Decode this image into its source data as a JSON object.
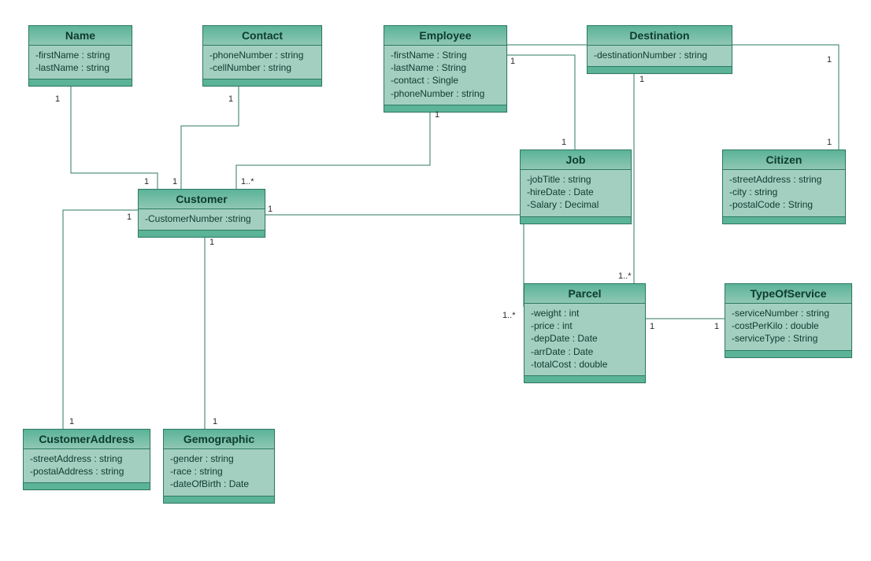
{
  "classes": {
    "name": {
      "title": "Name",
      "attrs": [
        "-firstName : string",
        "-lastName : string"
      ]
    },
    "contact": {
      "title": "Contact",
      "attrs": [
        "-phoneNumber : string",
        "-cellNumber : string"
      ]
    },
    "employee": {
      "title": "Employee",
      "attrs": [
        "-firstName : String",
        "-lastName : String",
        "-contact : Single",
        "-phoneNumber : string"
      ]
    },
    "destination": {
      "title": "Destination",
      "attrs": [
        "-destinationNumber : string"
      ]
    },
    "customer": {
      "title": "Customer",
      "attrs": [
        "-CustomerNumber :string"
      ]
    },
    "job": {
      "title": "Job",
      "attrs": [
        "-jobTitle : string",
        "-hireDate : Date",
        "-Salary : Decimal"
      ]
    },
    "citizen": {
      "title": "Citizen",
      "attrs": [
        "-streetAddress : string",
        "-city : string",
        "-postalCode : String"
      ]
    },
    "parcel": {
      "title": "Parcel",
      "attrs": [
        "-weight : int",
        "-price : int",
        "-depDate : Date",
        "-arrDate : Date",
        "-totalCost : double"
      ]
    },
    "typeofservice": {
      "title": "TypeOfService",
      "attrs": [
        "-serviceNumber : string",
        "-costPerKilo : double",
        "-serviceType : String"
      ]
    },
    "customeraddress": {
      "title": "CustomerAddress",
      "attrs": [
        "-streetAddress : string",
        "-postalAddress : string"
      ]
    },
    "gemographic": {
      "title": "Gemographic",
      "attrs": [
        "-gender : string",
        "-race : string",
        "-dateOfBirth : Date"
      ]
    }
  },
  "mults": {
    "name_bottom": "1",
    "contact_bottom": "1",
    "employee_right": "1",
    "employee_bottom": "1",
    "destination_left": "1",
    "destination_right": "1",
    "customer_name": "1",
    "customer_contact": "1",
    "customer_employee": "1..*",
    "customer_parcel": "1",
    "customer_addr": "1",
    "customer_gemo": "1",
    "job_top": "1",
    "citizen_top": "1",
    "parcel_left": "1..*",
    "parcel_top": "1..*",
    "parcel_right": "1",
    "tos_left": "1",
    "addr_top": "1",
    "gemo_top": "1"
  },
  "chart_data": {
    "type": "diagram",
    "diagram_type": "uml-class",
    "classes": [
      {
        "name": "Name",
        "attributes": [
          {
            "name": "firstName",
            "type": "string",
            "vis": "-"
          },
          {
            "name": "lastName",
            "type": "string",
            "vis": "-"
          }
        ]
      },
      {
        "name": "Contact",
        "attributes": [
          {
            "name": "phoneNumber",
            "type": "string",
            "vis": "-"
          },
          {
            "name": "cellNumber",
            "type": "string",
            "vis": "-"
          }
        ]
      },
      {
        "name": "Employee",
        "attributes": [
          {
            "name": "firstName",
            "type": "String",
            "vis": "-"
          },
          {
            "name": "lastName",
            "type": "String",
            "vis": "-"
          },
          {
            "name": "contact",
            "type": "Single",
            "vis": "-"
          },
          {
            "name": "phoneNumber",
            "type": "string",
            "vis": "-"
          }
        ]
      },
      {
        "name": "Destination",
        "attributes": [
          {
            "name": "destinationNumber",
            "type": "string",
            "vis": "-"
          }
        ]
      },
      {
        "name": "Customer",
        "attributes": [
          {
            "name": "CustomerNumber",
            "type": "string",
            "vis": "-"
          }
        ]
      },
      {
        "name": "Job",
        "attributes": [
          {
            "name": "jobTitle",
            "type": "string",
            "vis": "-"
          },
          {
            "name": "hireDate",
            "type": "Date",
            "vis": "-"
          },
          {
            "name": "Salary",
            "type": "Decimal",
            "vis": "-"
          }
        ]
      },
      {
        "name": "Citizen",
        "attributes": [
          {
            "name": "streetAddress",
            "type": "string",
            "vis": "-"
          },
          {
            "name": "city",
            "type": "string",
            "vis": "-"
          },
          {
            "name": "postalCode",
            "type": "String",
            "vis": "-"
          }
        ]
      },
      {
        "name": "Parcel",
        "attributes": [
          {
            "name": "weight",
            "type": "int",
            "vis": "-"
          },
          {
            "name": "price",
            "type": "int",
            "vis": "-"
          },
          {
            "name": "depDate",
            "type": "Date",
            "vis": "-"
          },
          {
            "name": "arrDate",
            "type": "Date",
            "vis": "-"
          },
          {
            "name": "totalCost",
            "type": "double",
            "vis": "-"
          }
        ]
      },
      {
        "name": "TypeOfService",
        "attributes": [
          {
            "name": "serviceNumber",
            "type": "string",
            "vis": "-"
          },
          {
            "name": "costPerKilo",
            "type": "double",
            "vis": "-"
          },
          {
            "name": "serviceType",
            "type": "String",
            "vis": "-"
          }
        ]
      },
      {
        "name": "CustomerAddress",
        "attributes": [
          {
            "name": "streetAddress",
            "type": "string",
            "vis": "-"
          },
          {
            "name": "postalAddress",
            "type": "string",
            "vis": "-"
          }
        ]
      },
      {
        "name": "Gemographic",
        "attributes": [
          {
            "name": "gender",
            "type": "string",
            "vis": "-"
          },
          {
            "name": "race",
            "type": "string",
            "vis": "-"
          },
          {
            "name": "dateOfBirth",
            "type": "Date",
            "vis": "-"
          }
        ]
      }
    ],
    "relationships": [
      {
        "from": "Customer",
        "to": "Name",
        "type": "aggregation",
        "from_mult": "1",
        "to_mult": "1"
      },
      {
        "from": "Customer",
        "to": "Contact",
        "type": "aggregation",
        "from_mult": "1",
        "to_mult": "1"
      },
      {
        "from": "Customer",
        "to": "Employee",
        "type": "association",
        "from_mult": "1..*",
        "to_mult": "1"
      },
      {
        "from": "Customer",
        "to": "CustomerAddress",
        "type": "association",
        "from_mult": "1",
        "to_mult": "1"
      },
      {
        "from": "Customer",
        "to": "Gemographic",
        "type": "aggregation",
        "from_mult": "1",
        "to_mult": "1"
      },
      {
        "from": "Customer",
        "to": "Parcel",
        "type": "association",
        "from_mult": "1",
        "to_mult": "1..*"
      },
      {
        "from": "Employee",
        "to": "Job",
        "type": "aggregation",
        "from_mult": "1",
        "to_mult": "1"
      },
      {
        "from": "Destination",
        "to": "Employee",
        "type": "aggregation",
        "from_mult": "1",
        "to_mult": "1"
      },
      {
        "from": "Destination",
        "to": "Citizen",
        "type": "aggregation",
        "from_mult": "1",
        "to_mult": "1"
      },
      {
        "from": "Destination",
        "to": "Parcel",
        "type": "association",
        "from_mult": "1",
        "to_mult": "1..*"
      },
      {
        "from": "Parcel",
        "to": "TypeOfService",
        "type": "association",
        "from_mult": "1",
        "to_mult": "1"
      }
    ]
  }
}
